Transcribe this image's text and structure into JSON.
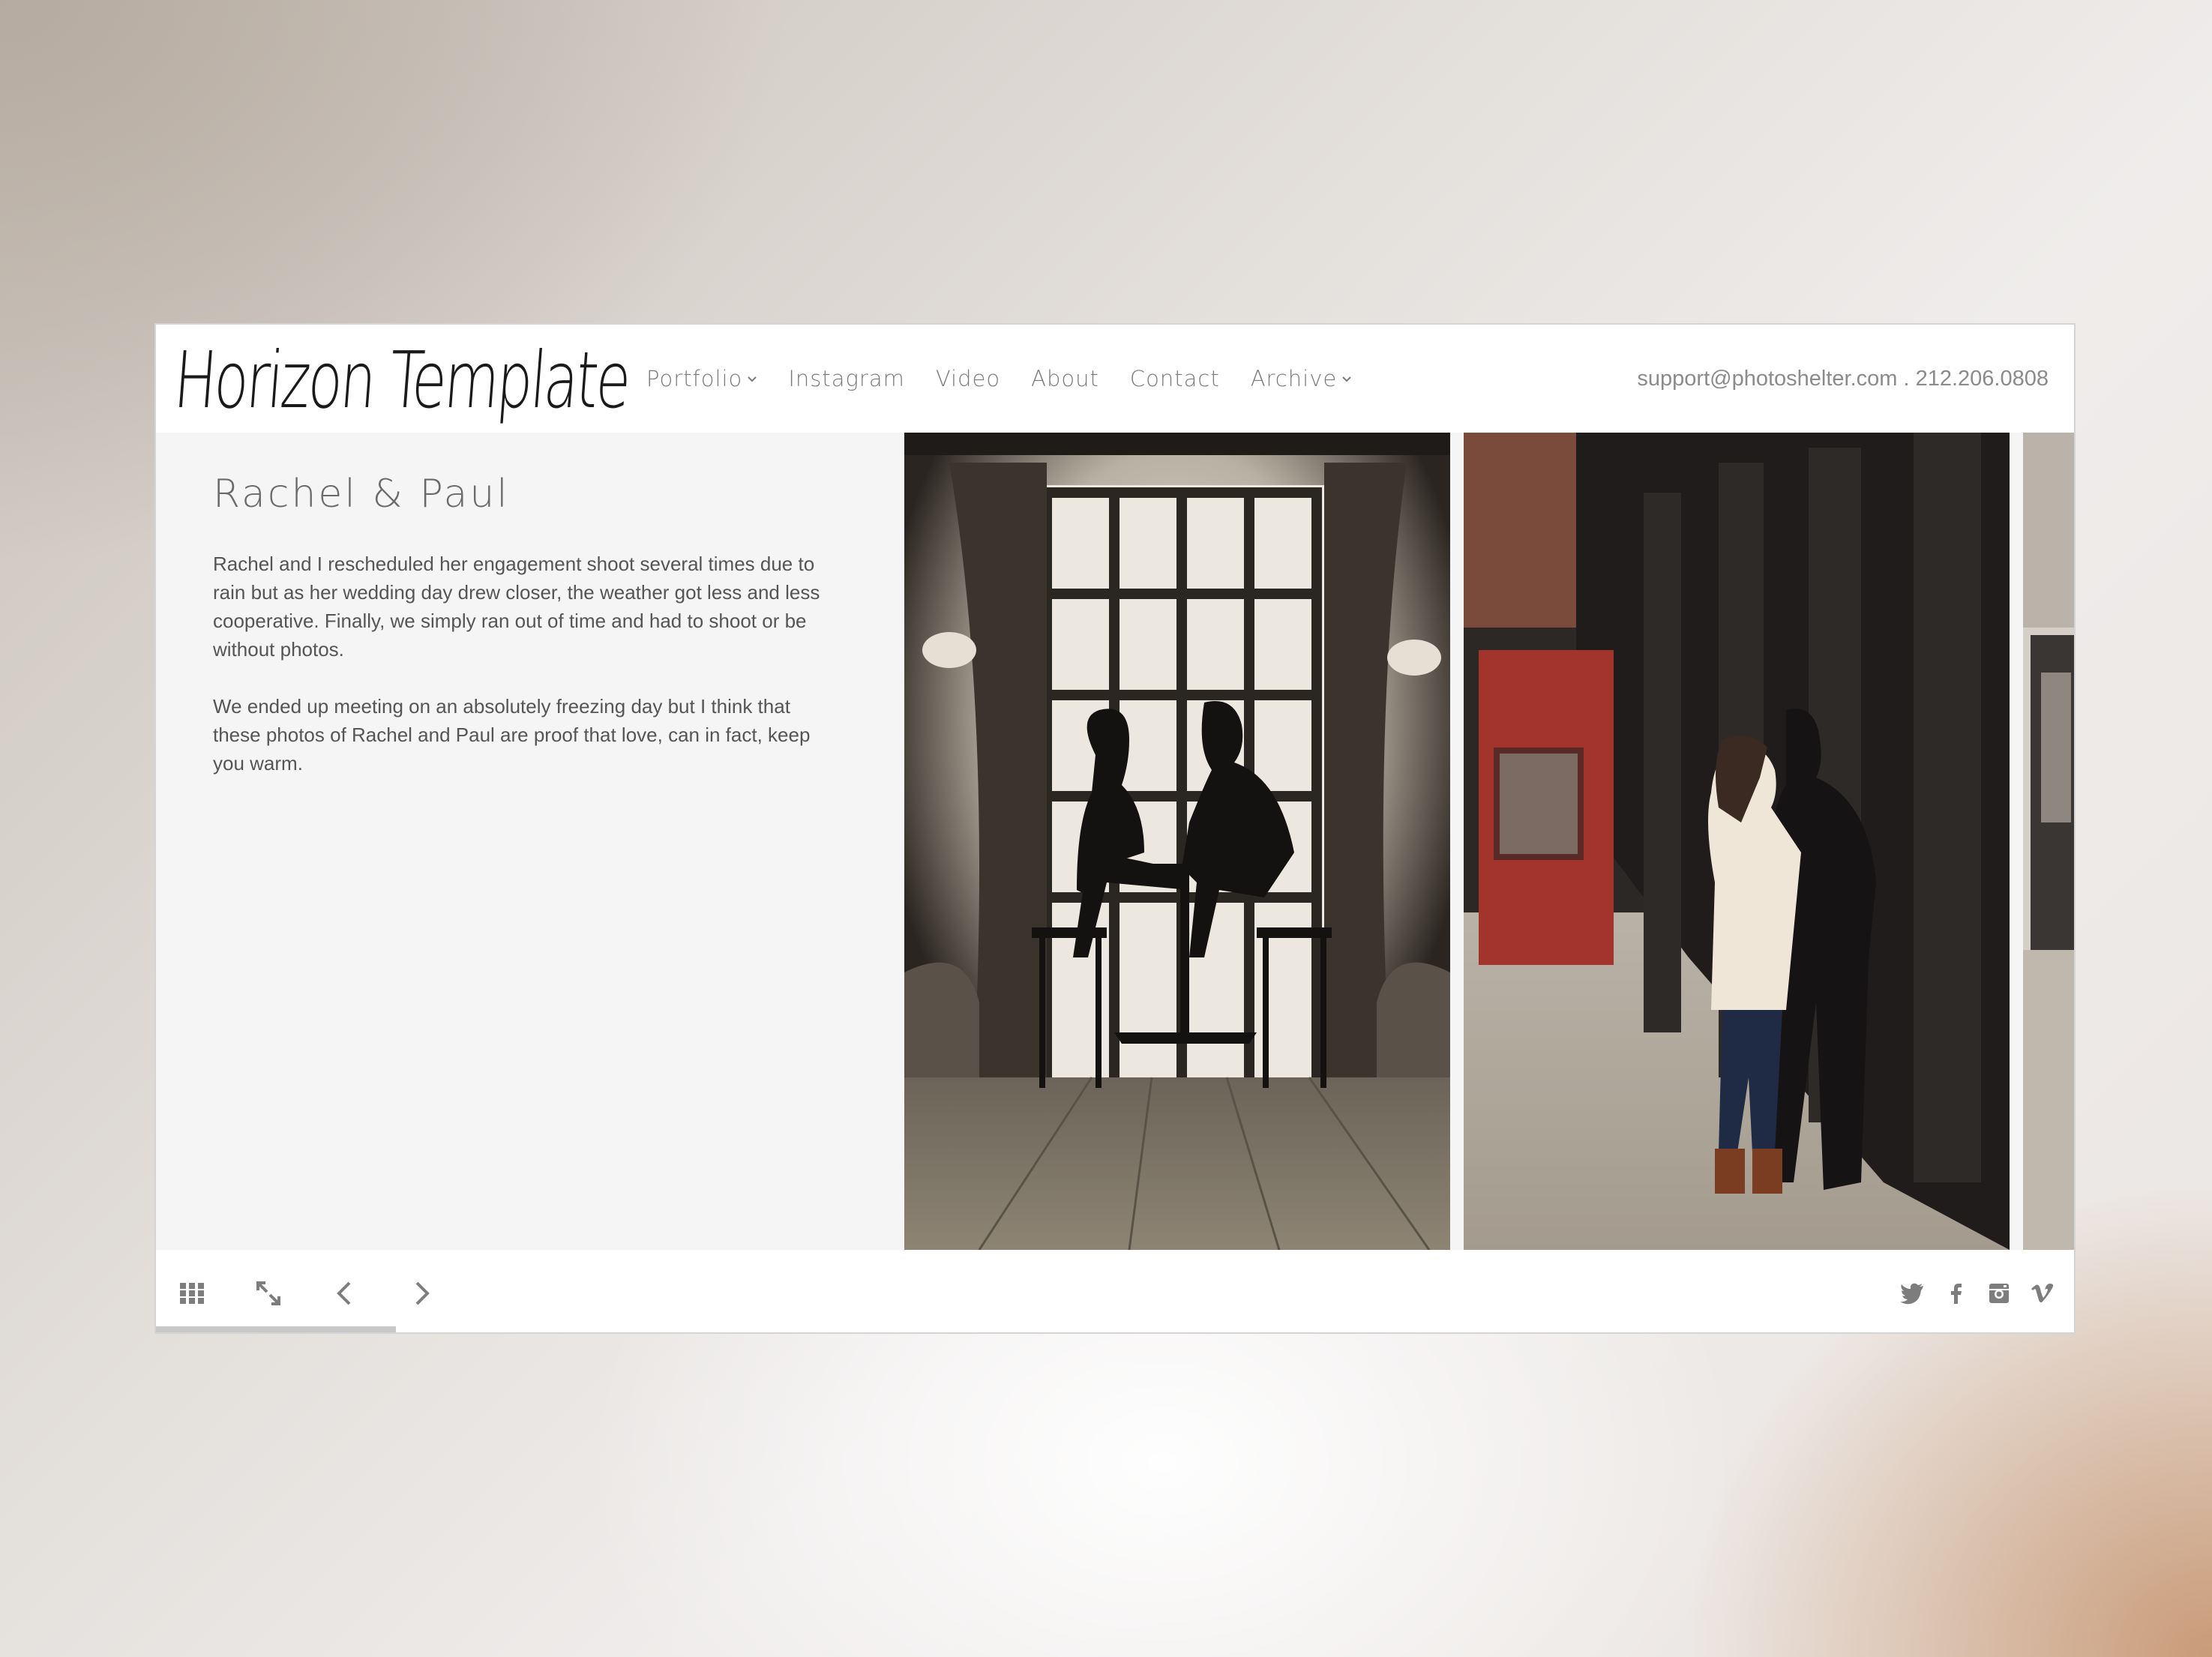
{
  "site": {
    "logo_text": "Horizon Template",
    "contact": "support@photoshelter.com . 212.206.0808"
  },
  "nav": [
    {
      "label": "Portfolio",
      "has_dropdown": true
    },
    {
      "label": "Instagram",
      "has_dropdown": false
    },
    {
      "label": "Video",
      "has_dropdown": false
    },
    {
      "label": "About",
      "has_dropdown": false
    },
    {
      "label": "Contact",
      "has_dropdown": false
    },
    {
      "label": "Archive",
      "has_dropdown": true
    }
  ],
  "gallery": {
    "title": "Rachel & Paul",
    "paragraphs": [
      "Rachel and I rescheduled her engagement shoot several times due to rain but as her wedding day drew closer, the weather got less and less cooperative. Finally, we simply ran out of time and had to shoot or be without photos.",
      "We ended up meeting on an absolutely freezing day but I think that these photos of Rachel and Paul are proof that love, can in fact, keep you warm."
    ]
  },
  "controls": [
    "grid-icon",
    "fullscreen-icon",
    "chevron-left-icon",
    "chevron-right-icon"
  ],
  "social": [
    "twitter-icon",
    "facebook-icon",
    "instagram-icon",
    "vimeo-icon"
  ],
  "progress": 0.125,
  "colors": {
    "icon": "#7d7d7d",
    "progress": "#c8c8c8",
    "door_red": "#a3342c"
  }
}
